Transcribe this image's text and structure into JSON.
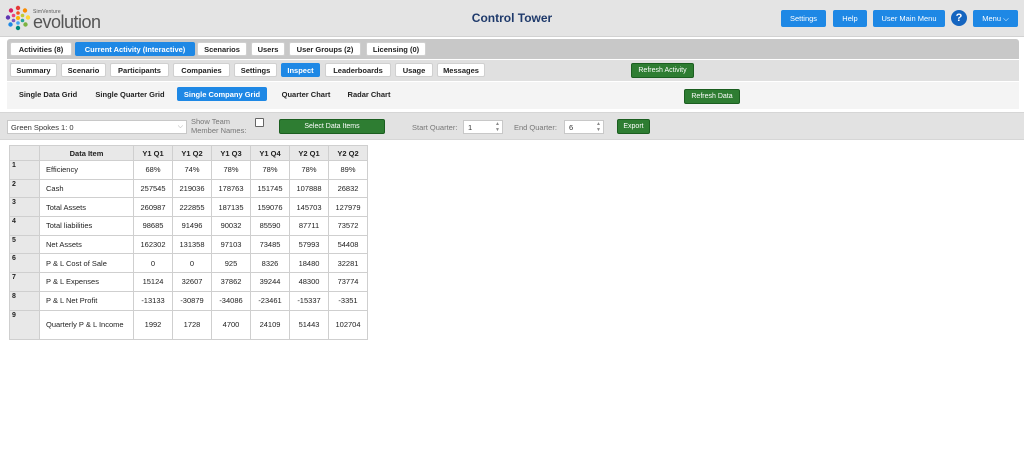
{
  "header": {
    "brand_small": "SimVenture",
    "brand": "evolution",
    "title": "Control Tower",
    "buttons": {
      "settings": "Settings",
      "help": "Help",
      "user_main_menu": "User Main Menu",
      "menu": "Menu ⌵"
    },
    "help_icon": "?"
  },
  "tabs_row1": [
    {
      "label": "Activities (8)",
      "active": false
    },
    {
      "label": "Current Activity (Interactive)",
      "active": true
    },
    {
      "label": "Scenarios",
      "active": false
    },
    {
      "label": "Users",
      "active": false
    },
    {
      "label": "User Groups (2)",
      "active": false
    },
    {
      "label": "Licensing (0)",
      "active": false
    }
  ],
  "tabs_row2": [
    {
      "label": "Summary",
      "active": false
    },
    {
      "label": "Scenario",
      "active": false
    },
    {
      "label": "Participants",
      "active": false
    },
    {
      "label": "Companies",
      "active": false
    },
    {
      "label": "Settings",
      "active": false
    },
    {
      "label": "Inspect",
      "active": true
    },
    {
      "label": "Leaderboards",
      "active": false
    },
    {
      "label": "Usage",
      "active": false
    },
    {
      "label": "Messages",
      "active": false
    }
  ],
  "refresh_activity": "Refresh Activity",
  "tabs_row3": [
    {
      "label": "Single Data Grid",
      "active": false
    },
    {
      "label": "Single Quarter Grid",
      "active": false
    },
    {
      "label": "Single Company Grid",
      "active": true
    },
    {
      "label": "Quarter Chart",
      "active": false
    },
    {
      "label": "Radar Chart",
      "active": false
    }
  ],
  "refresh_data": "Refresh Data",
  "controls": {
    "company_select": "Green Spokes 1: 0",
    "show_team_label_1": "Show Team",
    "show_team_label_2": "Member Names:",
    "select_data_items": "Select Data Items",
    "start_quarter_label": "Start Quarter:",
    "start_quarter_value": "1",
    "end_quarter_label": "End Quarter:",
    "end_quarter_value": "6",
    "export": "Export"
  },
  "table": {
    "headers": [
      "Data Item",
      "Y1 Q1",
      "Y1 Q2",
      "Y1 Q3",
      "Y1 Q4",
      "Y2 Q1",
      "Y2 Q2"
    ],
    "rows": [
      {
        "idx": "1",
        "name": "Efficiency",
        "values": [
          "68%",
          "74%",
          "78%",
          "78%",
          "78%",
          "89%"
        ]
      },
      {
        "idx": "2",
        "name": "Cash",
        "values": [
          "257545",
          "219036",
          "178763",
          "151745",
          "107888",
          "26832"
        ]
      },
      {
        "idx": "3",
        "name": "Total Assets",
        "values": [
          "260987",
          "222855",
          "187135",
          "159076",
          "145703",
          "127979"
        ]
      },
      {
        "idx": "4",
        "name": "Total liabilities",
        "values": [
          "98685",
          "91496",
          "90032",
          "85590",
          "87711",
          "73572"
        ]
      },
      {
        "idx": "5",
        "name": "Net Assets",
        "values": [
          "162302",
          "131358",
          "97103",
          "73485",
          "57993",
          "54408"
        ]
      },
      {
        "idx": "6",
        "name": "P & L Cost of Sale",
        "values": [
          "0",
          "0",
          "925",
          "8326",
          "18480",
          "32281"
        ]
      },
      {
        "idx": "7",
        "name": "P & L Expenses",
        "values": [
          "15124",
          "32607",
          "37862",
          "39244",
          "48300",
          "73774"
        ]
      },
      {
        "idx": "8",
        "name": "P & L Net Profit",
        "values": [
          "-13133",
          "-30879",
          "-34086",
          "-23461",
          "-15337",
          "-3351"
        ]
      },
      {
        "idx": "9",
        "name": "Quarterly P & L Income",
        "values": [
          "1992",
          "1728",
          "4700",
          "24109",
          "51443",
          "102704"
        ]
      }
    ]
  }
}
